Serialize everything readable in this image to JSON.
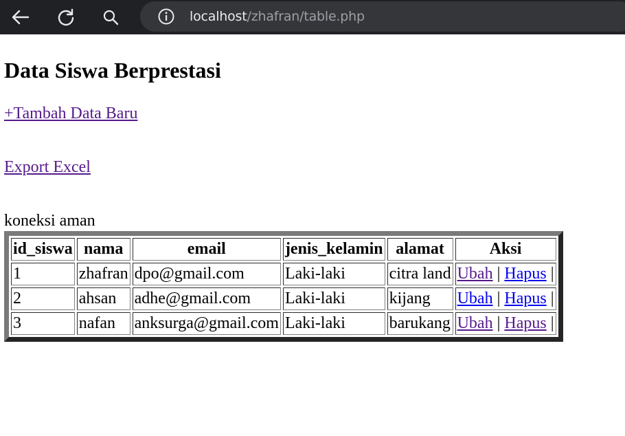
{
  "browser": {
    "url_host": "localhost",
    "url_path": "/zhafran/table.php"
  },
  "page": {
    "title": "Data Siswa Berprestasi",
    "add_link": "+Tambah Data Baru",
    "export_link": "Export Excel",
    "status": "koneksi aman"
  },
  "table": {
    "headers": [
      "id_siswa",
      "nama",
      "email",
      "jenis_kelamin",
      "alamat",
      "Aksi"
    ],
    "action_labels": {
      "edit": "Ubah",
      "delete": "Hapus",
      "separator": "|"
    },
    "rows": [
      {
        "id_siswa": "1",
        "nama": "zhafran",
        "email": "dpo@gmail.com",
        "jenis_kelamin": "Laki-laki",
        "alamat": "citra land"
      },
      {
        "id_siswa": "2",
        "nama": "ahsan",
        "email": "adhe@gmail.com",
        "jenis_kelamin": "Laki-laki",
        "alamat": "kijang"
      },
      {
        "id_siswa": "3",
        "nama": "nafan",
        "email": "anksurga@gmail.com",
        "jenis_kelamin": "Laki-laki",
        "alamat": "barukang"
      }
    ],
    "row_link_colors": [
      {
        "edit": "#551a8b",
        "delete": "#0000ee"
      },
      {
        "edit": "#0000ee",
        "delete": "#0000ee"
      },
      {
        "edit": "#551a8b",
        "delete": "#551a8b"
      }
    ]
  },
  "colors": {
    "visited_link": "#551a8b",
    "unvisited_link": "#0000ee",
    "browser_bar": "#202124"
  }
}
